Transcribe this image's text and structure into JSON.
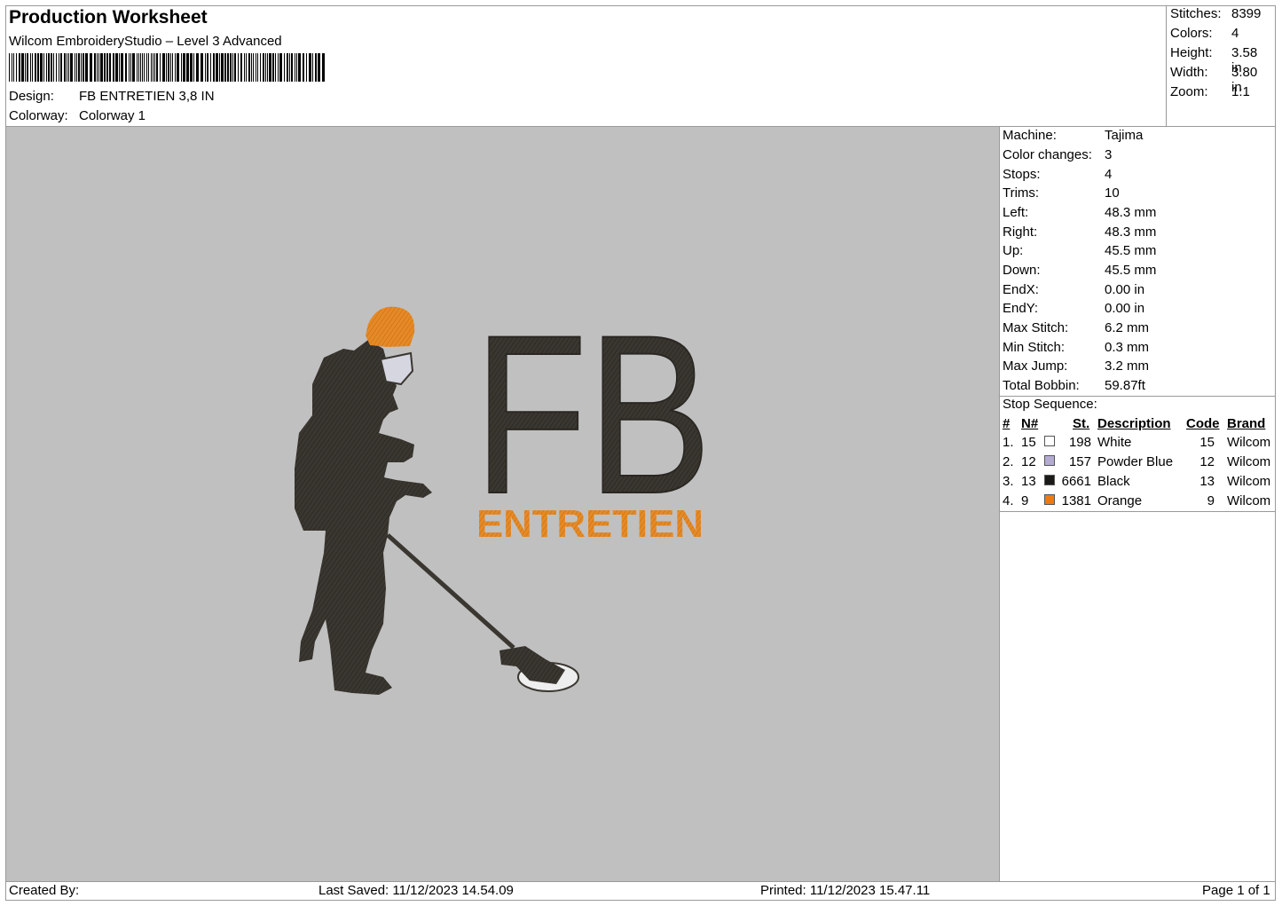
{
  "header": {
    "title": "Production Worksheet",
    "software": "Wilcom EmbroideryStudio – Level 3 Advanced",
    "design_label": "Design:",
    "design_value": "FB ENTRETIEN 3,8 IN",
    "colorway_label": "Colorway:",
    "colorway_value": "Colorway 1"
  },
  "summary": [
    {
      "label": "Stitches:",
      "value": "8399"
    },
    {
      "label": "Colors:",
      "value": "4"
    },
    {
      "label": "Height:",
      "value": "3.58 in"
    },
    {
      "label": "Width:",
      "value": "3.80 in"
    },
    {
      "label": "Zoom:",
      "value": "1:1"
    }
  ],
  "machine_info": [
    {
      "label": "Machine:",
      "value": "Tajima"
    },
    {
      "label": "Color changes:",
      "value": "3"
    },
    {
      "label": "Stops:",
      "value": "4"
    },
    {
      "label": "Trims:",
      "value": "10"
    },
    {
      "label": "Left:",
      "value": "48.3 mm"
    },
    {
      "label": "Right:",
      "value": "48.3 mm"
    },
    {
      "label": "Up:",
      "value": "45.5 mm"
    },
    {
      "label": "Down:",
      "value": "45.5 mm"
    },
    {
      "label": "EndX:",
      "value": "0.00 in"
    },
    {
      "label": "EndY:",
      "value": "0.00 in"
    },
    {
      "label": "Max Stitch:",
      "value": "6.2 mm"
    },
    {
      "label": "Min Stitch:",
      "value": "0.3 mm"
    },
    {
      "label": "Max Jump:",
      "value": "3.2 mm"
    },
    {
      "label": "Total Bobbin:",
      "value": "59.87ft"
    }
  ],
  "stop_sequence": {
    "title": "Stop Sequence:",
    "headers": {
      "num": "#",
      "n": "N#",
      "st": "St.",
      "desc": "Description",
      "code": "Code",
      "brand": "Brand"
    },
    "rows": [
      {
        "num": "1.",
        "n": "15",
        "color": "#ffffff",
        "st": "198",
        "desc": "White",
        "code": "15",
        "brand": "Wilcom"
      },
      {
        "num": "2.",
        "n": "12",
        "color": "#b4acd0",
        "st": "157",
        "desc": "Powder Blue",
        "code": "12",
        "brand": "Wilcom"
      },
      {
        "num": "3.",
        "n": "13",
        "color": "#1c1a18",
        "st": "6661",
        "desc": "Black",
        "code": "13",
        "brand": "Wilcom"
      },
      {
        "num": "4.",
        "n": "9",
        "color": "#ee7a14",
        "st": "1381",
        "desc": "Orange",
        "code": "9",
        "brand": "Wilcom"
      }
    ]
  },
  "design": {
    "text_big": "FB",
    "text_small": "ENTRETIEN",
    "colors": {
      "dark": "#3a3630",
      "orange": "#e58a26",
      "white": "#eeeeee",
      "visor": "#d6d6e0",
      "background": "#c0c0c0"
    }
  },
  "footer": {
    "created_by": "Created By:",
    "last_saved": "Last Saved: 11/12/2023 14.54.09",
    "printed": "Printed: 11/12/2023 15.47.11",
    "page": "Page 1 of 1"
  }
}
